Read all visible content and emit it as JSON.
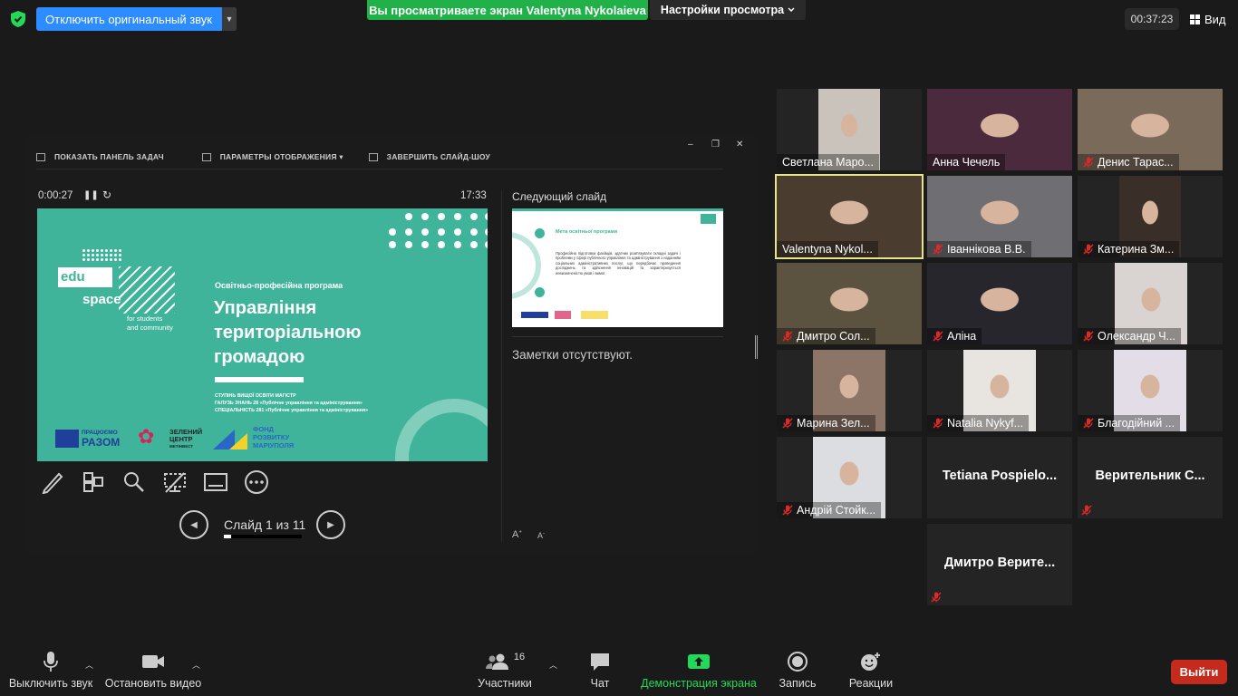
{
  "topbar": {
    "original_sound_button": "Отключить оригинальный звук",
    "share_banner": "Вы просматриваете экран Valentyna Nykolaieva",
    "view_settings": "Настройки просмотра",
    "timer": "00:37:23",
    "view_button": "Вид"
  },
  "presenter": {
    "toolbar": {
      "show_taskbar": "ПОКАЗАТЬ ПАНЕЛЬ ЗАДАЧ",
      "display_settings": "ПАРАМЕТРЫ ОТОБРАЖЕНИЯ ▾",
      "end_slideshow": "ЗАВЕРШИТЬ СЛАЙД-ШОУ"
    },
    "elapsed": "0:00:27",
    "clock": "17:33",
    "slide_counter": "Слайд 1 из 11",
    "slide_progress": 0.09,
    "next_slide_label": "Следующий слайд",
    "notes_text": "Заметки отсутствуют.",
    "current_slide": {
      "logo_edu": "edu",
      "logo_space": "space",
      "tagline_1": "for students",
      "tagline_2": "and community",
      "program_label": "Освітньо-професійна програма",
      "title_1": "Управління",
      "title_2": "територіальною",
      "title_3": "громадою",
      "degree_1": "СТУПІНЬ ВИЩОЇ ОСВІТИ   МАГІСТР",
      "degree_2": "ГАЛУЗЬ ЗНАНЬ    28 «Публічне управління та адміністрування»",
      "degree_3": "СПЕЦІАЛЬНІСТЬ    281 «Публічне управління та адміністрування»",
      "logo_razom_1": "ПРАЦЮЄМО",
      "logo_razom_2": "РАЗОМ",
      "logo_green_1": "ЗЕЛЕНИЙ",
      "logo_green_2": "ЦЕНТР",
      "logo_green_3": "МЕТІНВЕСТ",
      "logo_fund_1": "ФОНД",
      "logo_fund_2": "РОЗВИТКУ",
      "logo_fund_3": "МАРІУПОЛЯ"
    },
    "next_slide": {
      "title": "Мета освітньої програми",
      "text": "Професійна підготовка фахівців, здатних розв'язувати складні задачі і проблеми у сфері публічного управління та адміністрування з наданням соціальних адміністративних послуг, що передбачає проведення досліджень та здійснення інновацій та характеризується невизначеністю умов і вимог."
    }
  },
  "participants": [
    {
      "name": "Светлана Маро...",
      "muted": false
    },
    {
      "name": "Анна Чечель",
      "muted": false
    },
    {
      "name": "Денис Тарас...",
      "muted": true
    },
    {
      "name": "Valentyna Nykol...",
      "muted": false,
      "active": true
    },
    {
      "name": "Іваннікова В.В.",
      "muted": true
    },
    {
      "name": "Катерина Зм...",
      "muted": true
    },
    {
      "name": "Дмитро Сол...",
      "muted": true
    },
    {
      "name": "Аліна",
      "muted": true
    },
    {
      "name": "Олександр Ч...",
      "muted": true
    },
    {
      "name": "Марина Зел...",
      "muted": true
    },
    {
      "name": "Natalia Nykyf...",
      "muted": true
    },
    {
      "name": "Благодійний ...",
      "muted": true
    },
    {
      "name": "Андрій Стойк...",
      "muted": true
    },
    {
      "name": "Tetiana  Pospielo...",
      "muted": false
    },
    {
      "name": "Верительник  С...",
      "muted": true
    },
    {
      "name": "Дмитро  Верите...",
      "muted": true
    }
  ],
  "bottombar": {
    "mute": "Выключить звук",
    "video": "Остановить видео",
    "participants": "Участники",
    "participants_count": "16",
    "chat": "Чат",
    "share": "Демонстрация экрана",
    "record": "Запись",
    "reactions": "Реакции",
    "leave": "Выйти"
  },
  "colors": {
    "zoom_blue": "#2d8cff",
    "share_green": "#20b248",
    "slide_teal": "#3fb49a",
    "leave_red": "#c42b1c",
    "active_speaker": "#e8e48a"
  }
}
